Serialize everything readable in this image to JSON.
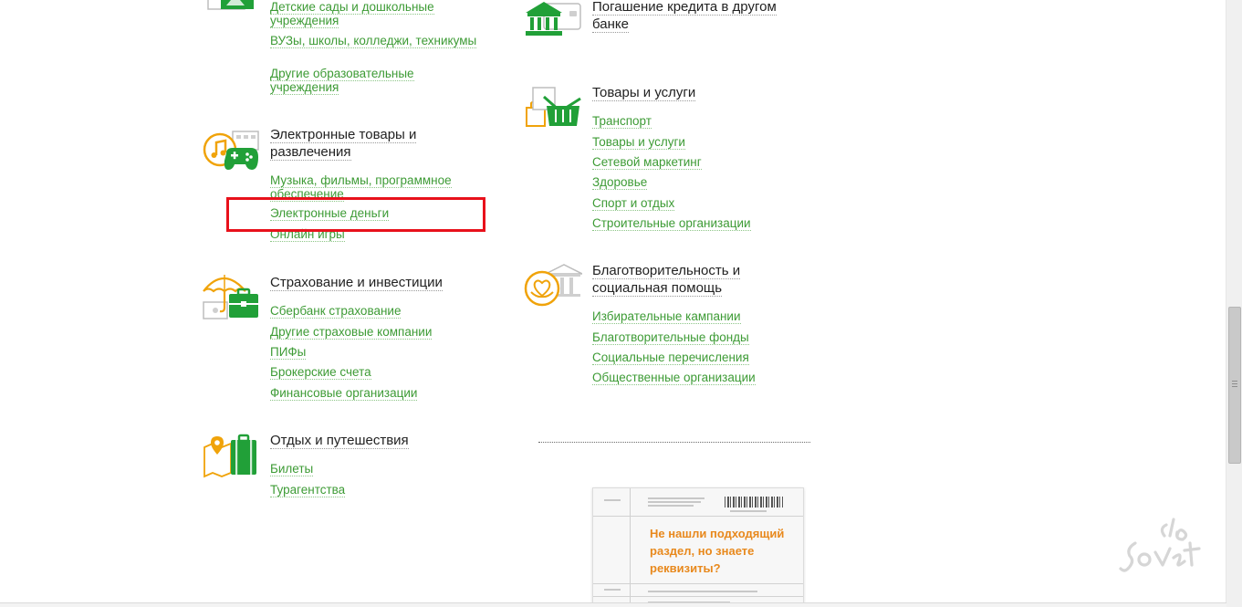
{
  "left_column": {
    "education": {
      "links": [
        "Детские сады и дошкольные учреждения",
        "ВУЗы, школы, колледжи, техникумы",
        "Другие образовательные учреждения"
      ]
    },
    "electronic_goods": {
      "title": "Электронные товары и развлечения",
      "links": [
        "Музыка, фильмы, программное обеспечение",
        "Электронные деньги",
        "Онлайн игры"
      ]
    },
    "insurance": {
      "title": "Страхование и инвестиции",
      "links": [
        "Сбербанк страхование",
        "Другие страховые компании",
        "ПИФы",
        "Брокерские счета",
        "Финансовые организации"
      ]
    },
    "travel": {
      "title": "Отдых и путешествия",
      "links": [
        "Билеты",
        "Турагентства"
      ]
    }
  },
  "right_column": {
    "loan": {
      "title": "Погашение кредита в другом банке"
    },
    "goods": {
      "title": "Товары и услуги",
      "links": [
        "Транспорт",
        "Товары и услуги",
        "Сетевой маркетинг",
        "Здоровье",
        "Спорт и отдых",
        "Строительные организации"
      ]
    },
    "charity": {
      "title": "Благотворительность и социальная помощь",
      "links": [
        "Избирательные кампании",
        "Благотворительные фонды",
        "Социальные перечисления",
        "Общественные организации"
      ]
    }
  },
  "receipt_card": {
    "text": "Не нашли подходящий раздел, но знаете реквизиты?"
  },
  "colors": {
    "link_green": "#3d9b35",
    "icon_green": "#21a038",
    "icon_orange": "#f0a30a",
    "highlight_red": "#e8111b",
    "receipt_orange": "#e8891d"
  },
  "icons": {
    "education": "school-icon",
    "electronic_goods": "music-gamepad-icon",
    "insurance": "umbrella-briefcase-icon",
    "travel": "map-suitcase-icon",
    "loan": "bank-building-icon",
    "goods": "shopping-basket-icon",
    "charity": "charity-heart-icon"
  }
}
